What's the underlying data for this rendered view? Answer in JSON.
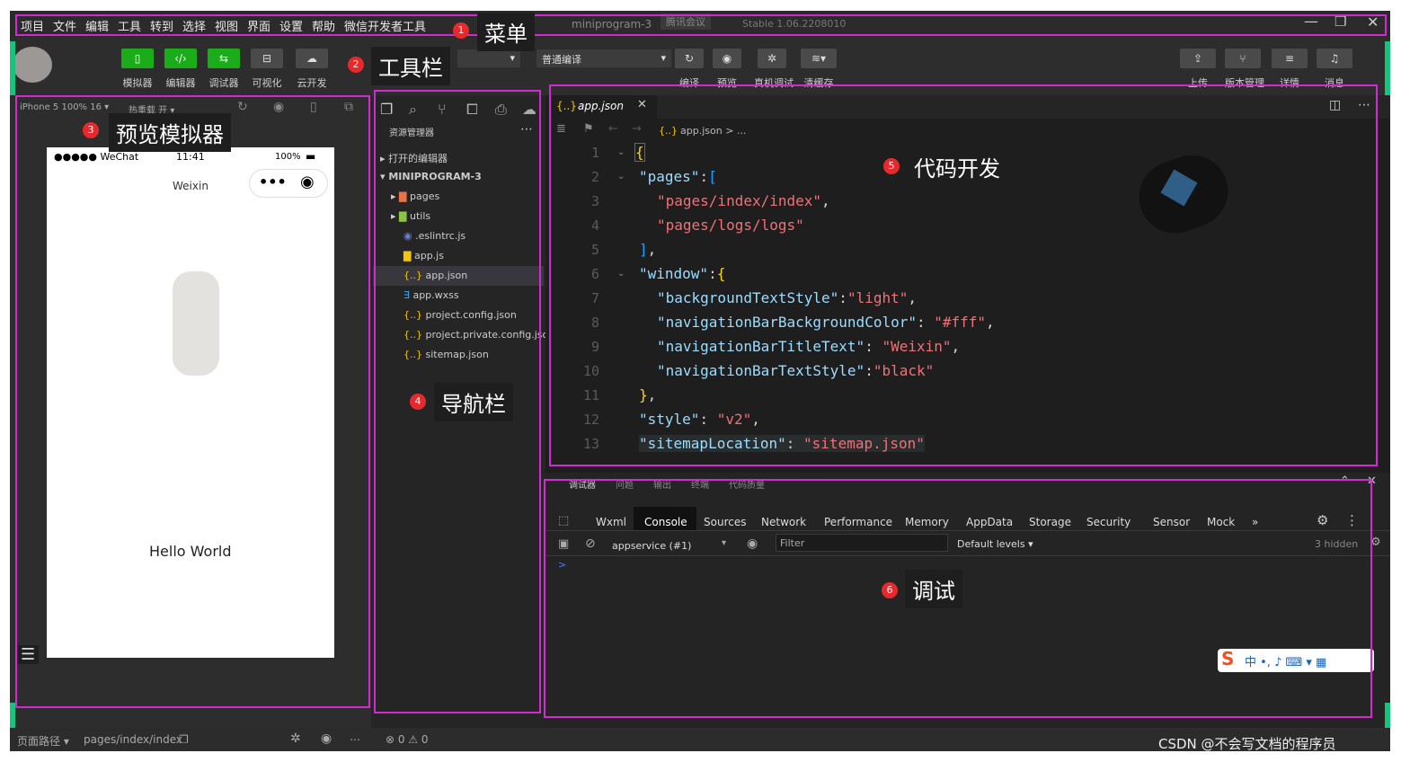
{
  "menubar": {
    "items": [
      "项目",
      "文件",
      "编辑",
      "工具",
      "转到",
      "选择",
      "视图",
      "界面",
      "设置",
      "帮助",
      "微信开发者工具"
    ],
    "project_name": "miniprogram-3",
    "meeting": "腾讯会议",
    "version": "Stable 1.06.2208010"
  },
  "toolbar": {
    "left_buttons": [
      "模拟器",
      "编辑器",
      "调试器",
      "可视化",
      "云开发"
    ],
    "compile_mode": "普通编译",
    "center_buttons": [
      "编译",
      "预览",
      "真机调试",
      "清缓存"
    ],
    "right_buttons": [
      "上传",
      "版本管理",
      "详情",
      "消息"
    ]
  },
  "simulator": {
    "device": "iPhone 5 100% 16",
    "hot_reload": "热重载 开",
    "status_carrier": "●●●●● WeChat",
    "status_time": "11:41",
    "status_battery": "100%",
    "nav_title": "Weixin",
    "hello_text": "Hello World"
  },
  "explorer": {
    "title": "资源管理器",
    "open_editors": "打开的编辑器",
    "project": "MINIPROGRAM-3",
    "items": [
      "pages",
      "utils",
      ".eslintrc.js",
      "app.js",
      "app.json",
      "app.wxss",
      "project.config.json",
      "project.private.config.json",
      "sitemap.json"
    ]
  },
  "editor": {
    "tab_name": "app.json",
    "breadcrumb": "app.json > ...",
    "line_numbers": [
      "1",
      "2",
      "3",
      "4",
      "5",
      "6",
      "7",
      "8",
      "9",
      "10",
      "11",
      "12",
      "13"
    ]
  },
  "devtools": {
    "top_tabs": [
      "调试器",
      "问题",
      "输出",
      "终端",
      "代码质量"
    ],
    "tabs": [
      "Wxml",
      "Console",
      "Sources",
      "Network",
      "Performance",
      "Memory",
      "AppData",
      "Storage",
      "Security",
      "Sensor",
      "Mock"
    ],
    "context": "appservice (#1)",
    "filter_placeholder": "Filter",
    "levels": "Default levels",
    "hidden": "3 hidden",
    "prompt": ">"
  },
  "statusbar": {
    "page_path_label": "页面路径",
    "page_path": "pages/index/index",
    "errors": "⊗ 0 ⚠ 0"
  },
  "annotations": {
    "menu": {
      "num": "1",
      "label": "菜单"
    },
    "toolbar": {
      "num": "2",
      "label": "工具栏"
    },
    "simulator": {
      "num": "3",
      "label": "预览模拟器"
    },
    "navigator": {
      "num": "4",
      "label": "导航栏"
    },
    "code": {
      "num": "5",
      "label": "代码开发"
    },
    "debug": {
      "num": "6",
      "label": "调试"
    }
  },
  "watermark": "CSDN @不会写文档的程序员",
  "colors": {
    "accent_green": "#1aad19",
    "annotation_magenta": "#d12ad1",
    "badge_red": "#e7292e"
  }
}
